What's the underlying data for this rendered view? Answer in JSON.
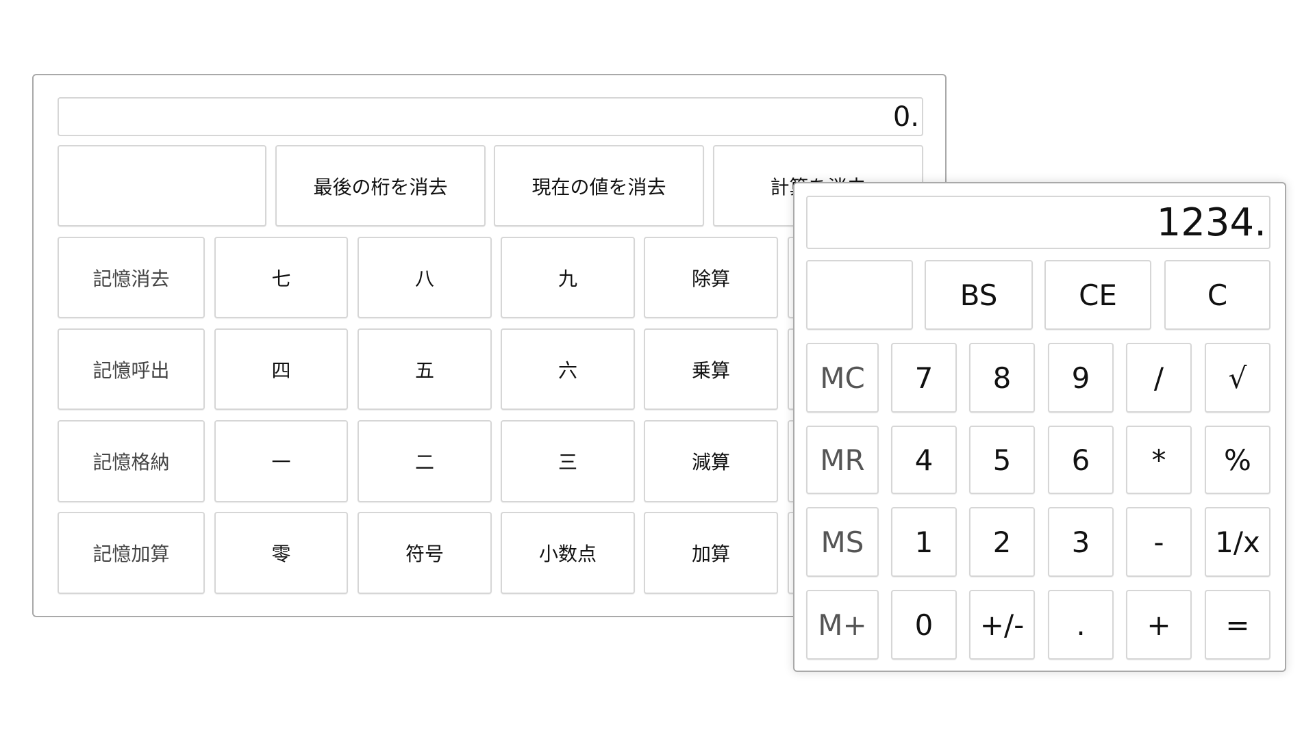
{
  "japanese_calculator": {
    "display": "0.",
    "top_row": [
      "",
      "最後の桁を消去",
      "現在の値を消去",
      "計算を消去"
    ],
    "rows": [
      [
        "記憶消去",
        "七",
        "八",
        "九",
        "除算",
        ""
      ],
      [
        "記憶呼出",
        "四",
        "五",
        "六",
        "乗算",
        ""
      ],
      [
        "記憶格納",
        "一",
        "二",
        "三",
        "減算",
        ""
      ],
      [
        "記憶加算",
        "零",
        "符号",
        "小数点",
        "加算",
        ""
      ]
    ]
  },
  "standard_calculator": {
    "display": "1234.",
    "top_row": [
      "",
      "BS",
      "CE",
      "C"
    ],
    "rows": [
      [
        "MC",
        "7",
        "8",
        "9",
        "/",
        "√"
      ],
      [
        "MR",
        "4",
        "5",
        "6",
        "*",
        "%"
      ],
      [
        "MS",
        "1",
        "2",
        "3",
        "-",
        "1/x"
      ],
      [
        "M+",
        "0",
        "+/-",
        ".",
        "+",
        "="
      ]
    ]
  }
}
